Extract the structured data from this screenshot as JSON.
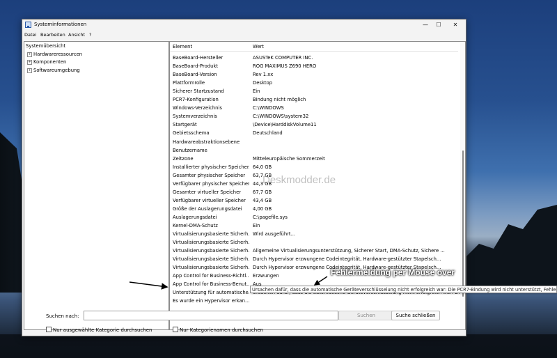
{
  "window": {
    "title": "Systeminformationen",
    "controls": {
      "minimize": "—",
      "maximize": "☐",
      "close": "✕"
    }
  },
  "menu": [
    "Datei",
    "Bearbeiten",
    "Ansicht",
    "?"
  ],
  "tree": {
    "root": "Systemübersicht",
    "children": [
      "Hardwareressourcen",
      "Komponenten",
      "Softwareumgebung"
    ],
    "expander": "+"
  },
  "table": {
    "columns": [
      "Element",
      "Wert"
    ],
    "rows": [
      [
        "BaseBoard-Hersteller",
        "ASUSTeK COMPUTER INC."
      ],
      [
        "BaseBoard-Produkt",
        "ROG MAXIMUS Z690 HERO"
      ],
      [
        "BaseBoard-Version",
        "Rev 1.xx"
      ],
      [
        "Plattformrolle",
        "Desktop"
      ],
      [
        "Sicherer Startzustand",
        "Ein"
      ],
      [
        "PCR7-Konfiguration",
        "Bindung nicht möglich"
      ],
      [
        "Windows-Verzeichnis",
        "C:\\WINDOWS"
      ],
      [
        "Systemverzeichnis",
        "C:\\WINDOWS\\system32"
      ],
      [
        "Startgerät",
        "\\Device\\HarddiskVolume11"
      ],
      [
        "Gebietsschema",
        "Deutschland"
      ],
      [
        "Hardwareabstraktionsebene",
        ""
      ],
      [
        "Benutzername",
        ""
      ],
      [
        "Zeitzone",
        "Mitteleuropäische Sommerzeit"
      ],
      [
        "Installierter physischer Speicher...",
        "64,0 GB"
      ],
      [
        "Gesamter physischer Speicher",
        "63,7 GB"
      ],
      [
        "Verfügbarer physischer Speicher",
        "44,3 GB"
      ],
      [
        "Gesamter virtueller Speicher",
        "67,7 GB"
      ],
      [
        "Verfügbarer virtueller Speicher",
        "43,4 GB"
      ],
      [
        "Größe der Auslagerungsdatei",
        "4,00 GB"
      ],
      [
        "Auslagerungsdatei",
        "C:\\pagefile.sys"
      ],
      [
        "Kernel-DMA-Schutz",
        "Ein"
      ],
      [
        "Virtualisierungsbasierte Sicherh...",
        "Wird ausgeführt..."
      ],
      [
        "Virtualisierungsbasierte Sicherh...",
        ""
      ],
      [
        "Virtualisierungsbasierte Sicherh...",
        "Allgemeine Virtualisierungsunterstützung, Sicherer Start, DMA-Schutz, Sichere ..."
      ],
      [
        "Virtualisierungsbasierte Sicherh...",
        "Durch Hypervisor erzwungene Codeintegrität, Hardware-gestützter Stapelsch..."
      ],
      [
        "Virtualisierungsbasierte Sicherh...",
        "Durch Hypervisor erzwungene Codeintegrität, Hardware-gestützter Stapelsch..."
      ],
      [
        "App Control for Business-Richtl...",
        "Erzwungen"
      ],
      [
        "App Control for Business-Benut...",
        "Aus"
      ],
      [
        "Unterstützung für automatische...",
        "Ursachen dafür, dass die automatische Geräteverschlüsselung nicht erfolgreich war: Die PCR7-Bindung wird nicht unterstützt, Fehler"
      ],
      [
        "Es wurde ein Hypervisor erkan...",
        ""
      ]
    ]
  },
  "tooltip": "Ursachen dafür, dass die automatische Geräteverschlüsselung nicht erfolgreich war: Die PCR7-Bindung wird nicht unterstützt, Fehler",
  "search": {
    "label": "Suchen nach:",
    "value": "",
    "search_button": "Suchen",
    "close_button": "Suche schließen"
  },
  "checkboxes": [
    "Nur ausgewählte Kategorie durchsuchen",
    "Nur Kategorienamen durchsuchen"
  ],
  "annotation": "Fehlermeldung per Mouse over",
  "watermark": "Deskmodder.de",
  "colors": {
    "annotation_arrow": "#000000",
    "selected_bg": "#cce4f7"
  }
}
